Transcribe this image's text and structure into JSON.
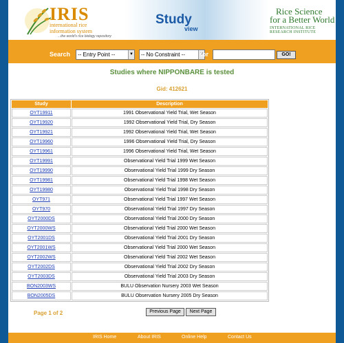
{
  "header": {
    "iris_title": "IRIS",
    "iris_subtitle_1": "international rice",
    "iris_subtitle_2": "information system",
    "iris_tagline": "...the world's rice biology repository",
    "study_word": "Study",
    "view_word": "view",
    "partner_line_1": "Rice Science",
    "partner_line_2": "for a Better World",
    "partner_name": "INTERNATIONAL RICE RESEARCH INSTITUTE"
  },
  "search": {
    "label": "Search",
    "entry_point": "-- Entry Point --",
    "constraint": "-- No Constraint --",
    "for_label": "for",
    "query_value": "",
    "go_label": "GO!"
  },
  "page": {
    "heading": "Studies where NIPPONBARE is tested",
    "gid_line": "Gid: 412621"
  },
  "table": {
    "headers": [
      "Study",
      "Description"
    ],
    "rows": [
      {
        "study": "OYT19911",
        "description": "1991 Observational Yield Trial, Wet Season"
      },
      {
        "study": "OYT19920",
        "description": "1992 Observational Yield Trial, Dry Season"
      },
      {
        "study": "OYT19921",
        "description": "1992 Observational Yield Trial, Wet Season"
      },
      {
        "study": "OYT19960",
        "description": "1996 Observational Yield Trial, Dry Season"
      },
      {
        "study": "OYT19961",
        "description": "1996 Observational Yield Trial, Wet Season"
      },
      {
        "study": "OYT19991",
        "description": "Observational Yield Trial 1999 Wet Season"
      },
      {
        "study": "OYT19990",
        "description": "Observational Yield Trial 1999 Dry Season"
      },
      {
        "study": "OYT19981",
        "description": "Observational Yield Trial 1998 Wet Season"
      },
      {
        "study": "OYT19980",
        "description": "Observational Yield Trial 1998 Dry Season"
      },
      {
        "study": "OYT971",
        "description": "Observational Yield Trial 1997 Wet Season"
      },
      {
        "study": "OYT970",
        "description": "Observational Yield Trial 1997 Dry Season"
      },
      {
        "study": "OYT2000DS",
        "description": "Observational Yield Trial 2000 Dry Season"
      },
      {
        "study": "OYT2000WS",
        "description": "Observational Yield Trial 2000 Wet Season"
      },
      {
        "study": "OYT2001DS",
        "description": "Observational Yield Trial 2001 Dry Season"
      },
      {
        "study": "OYT2001WS",
        "description": "Observational Yield Trial 2000 Wet Season"
      },
      {
        "study": "OYT2002WS",
        "description": "Observational Yield Trial 2002 Wet Season"
      },
      {
        "study": "OYT2002DS",
        "description": "Observational Yield Trial 2002 Dry Season"
      },
      {
        "study": "OYT2003DS",
        "description": "Observational Yield Trial 2003 Dry Season"
      },
      {
        "study": "BON2003WS",
        "description": "BULU Observation Nursery 2003 Wet Season"
      },
      {
        "study": "BON2005DS",
        "description": "BULU Observation Nursery 2005 Dry Season"
      }
    ]
  },
  "pagination": {
    "page_info": "Page 1 of 2",
    "previous_label": "Previous Page",
    "next_label": "Next Page"
  },
  "footer": {
    "links": [
      "IRIS Home",
      "About IRIS",
      "Online Help",
      "Contact Us"
    ]
  },
  "colors": {
    "background": "#0f5a96",
    "accent_orange": "#f0a020",
    "heading_green": "#5a8f3b",
    "gid_gold": "#d9a030",
    "link_blue": "#1a3bb2"
  }
}
